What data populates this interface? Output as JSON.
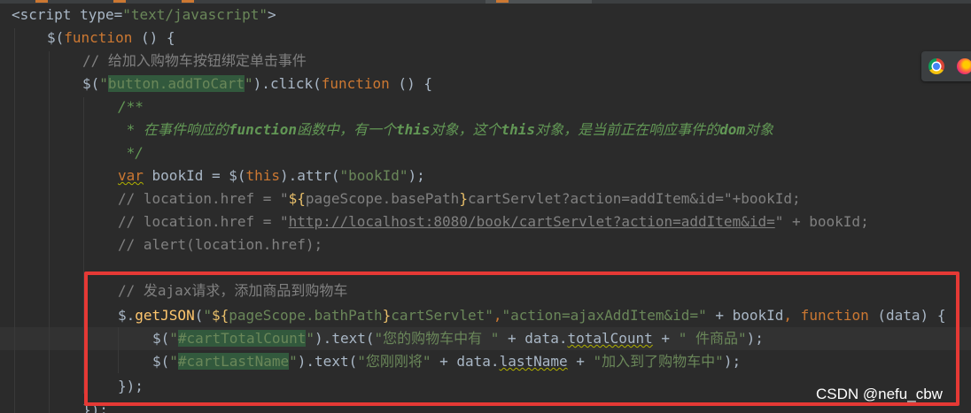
{
  "code": {
    "l1": {
      "a": "<script type=",
      "b": "\"text/javascript\"",
      "c": ">"
    },
    "l2": {
      "a": "$(",
      "b": "function",
      "c": " () {"
    },
    "l3": {
      "a": "// 给加入购物车按钮绑定单击事件"
    },
    "l4": {
      "a": "$(",
      "b": "\"",
      "c": "button.addToCart",
      "d": "\"",
      "e": ").click(",
      "f": "function",
      "g": " () {"
    },
    "l5": {
      "a": "/**"
    },
    "l6": {
      "a": " * 在事件响应的",
      "b": "function",
      "c": "函数中，有一个",
      "d": "this",
      "e": "对象，这个",
      "f": "this",
      "g": "对象，是当前正在响应事件的",
      "h": "dom",
      "i": "对象"
    },
    "l7": {
      "a": " */"
    },
    "l8": {
      "a": "var",
      "b": " bookId = $(",
      "c": "this",
      "d": ").attr(",
      "e": "\"bookId\"",
      "f": ");"
    },
    "l9": {
      "a": "// location.href = \"",
      "b": "${",
      "c": "pageScope.basePath",
      "d": "}",
      "e": "cartServlet?action=addItem&id=\"+bookId;"
    },
    "l10": {
      "a": "// location.href = \"",
      "b": "http://localhost:8080/book/cartServlet?action=addItem&id=",
      "c": "\" + bookId;"
    },
    "l11": {
      "a": "// alert(location.href);"
    },
    "l12": {
      "a": "// 发ajax请求，添加商品到购物车"
    },
    "l13": {
      "a": "$.",
      "b": "getJSON",
      "c": "(",
      "d": "\"",
      "e": "${",
      "f": "pageScope.bathPath",
      "g": "}",
      "h": "cartServlet\"",
      "i": ",",
      "j": "\"action=ajaxAddItem&id=\"",
      "k": " + bookId",
      "l": ",",
      "m": " function",
      "n": " (data) {"
    },
    "l14": {
      "a": "$(",
      "b": "\"",
      "c": "#cartTotalCount",
      "d": "\"",
      "e": ").text(",
      "f": "\"您的购物车中有 \"",
      "g": " + data.",
      "h": "totalCount",
      "i": " + ",
      "j": "\" 件商品\"",
      "k": ");"
    },
    "l15": {
      "a": "$(",
      "b": "\"",
      "c": "#cartLastName",
      "d": "\"",
      "e": ").text(",
      "f": "\"您刚刚将\"",
      "g": " + data.",
      "h": "lastName",
      "i": " + ",
      "j": "\"加入到了购物车中\"",
      "k": ");"
    },
    "l16": {
      "a": "});"
    },
    "l17": {
      "a": "});"
    }
  },
  "watermark": "CSDN @nefu_cbw",
  "colors": {
    "background": "#2b2b2b",
    "keyword": "#cc7832",
    "string": "#6a8759",
    "comment": "#808080",
    "doc_comment": "#629755",
    "annotation_box": "#e53935"
  }
}
